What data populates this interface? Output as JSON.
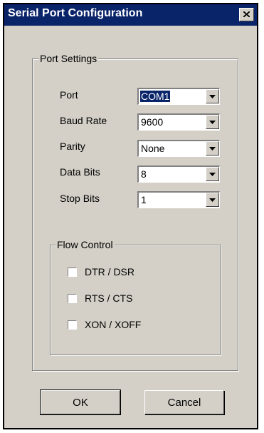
{
  "window": {
    "title": "Serial Port Configuration",
    "close_glyph": "close-icon"
  },
  "port_settings": {
    "legend": "Port Settings",
    "fields": [
      {
        "label": "Port",
        "value": "COM1"
      },
      {
        "label": "Baud Rate",
        "value": "9600"
      },
      {
        "label": "Parity",
        "value": "None"
      },
      {
        "label": "Data Bits",
        "value": "8"
      },
      {
        "label": "Stop Bits",
        "value": "1"
      }
    ]
  },
  "flow_control": {
    "legend": "Flow Control",
    "options": [
      {
        "label": "DTR / DSR",
        "checked": false
      },
      {
        "label": "RTS / CTS",
        "checked": false
      },
      {
        "label": "XON / XOFF",
        "checked": false
      }
    ]
  },
  "buttons": {
    "ok": "OK",
    "cancel": "Cancel"
  },
  "colors": {
    "titlebar": "#0a246a",
    "face": "#d4d0c8",
    "selection": "#0a246a"
  }
}
